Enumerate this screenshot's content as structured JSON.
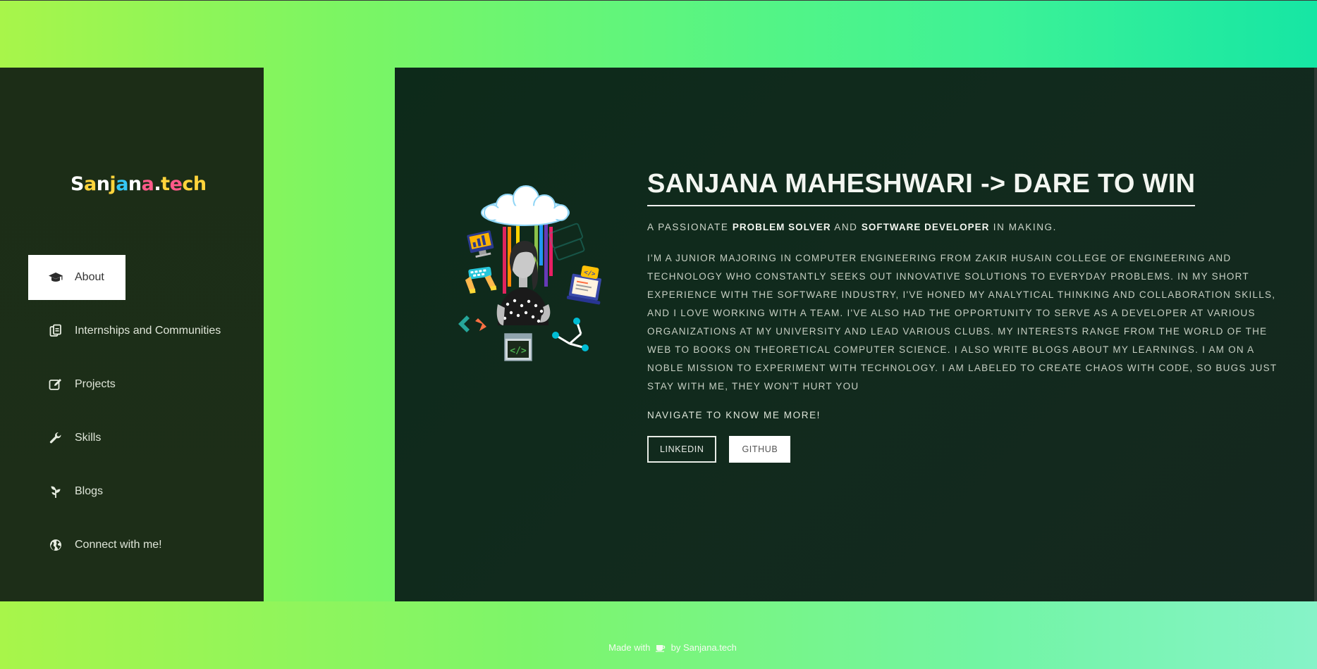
{
  "brand": {
    "letters": [
      {
        "ch": "S",
        "color": "#ffffff"
      },
      {
        "ch": "a",
        "color": "#ffd43b"
      },
      {
        "ch": "n",
        "color": "#ffffff"
      },
      {
        "ch": "j",
        "color": "#ffd43b"
      },
      {
        "ch": "a",
        "color": "#36c7f5"
      },
      {
        "ch": "n",
        "color": "#ffffff"
      },
      {
        "ch": "a",
        "color": "#ff5a8a"
      },
      {
        "ch": ".",
        "color": "#ffffff"
      },
      {
        "ch": "t",
        "color": "#ffd43b"
      },
      {
        "ch": "e",
        "color": "#ff5a8a"
      },
      {
        "ch": "c",
        "color": "#ffd43b"
      },
      {
        "ch": "h",
        "color": "#ffd43b"
      }
    ]
  },
  "sidebar": {
    "items": [
      {
        "label": "About",
        "icon": "graduation-cap-icon",
        "active": true
      },
      {
        "label": "Internships and Communities",
        "icon": "clipboard-copy-icon",
        "active": false
      },
      {
        "label": "Projects",
        "icon": "edit-icon",
        "active": false
      },
      {
        "label": "Skills",
        "icon": "wrench-icon",
        "active": false
      },
      {
        "label": "Blogs",
        "icon": "seedling-icon",
        "active": false
      },
      {
        "label": "Connect with me!",
        "icon": "globe-icon",
        "active": false
      }
    ]
  },
  "main": {
    "headline": "SANJANA MAHESHWARI -> DARE TO WIN",
    "tagline": {
      "prefix": "A PASSIONATE ",
      "bold1": "PROBLEM SOLVER",
      "mid": " AND ",
      "bold2": "SOFTWARE DEVELOPER",
      "suffix": " IN MAKING."
    },
    "bio": "I'M A JUNIOR MAJORING IN COMPUTER ENGINEERING FROM ZAKIR HUSAIN COLLEGE OF ENGINEERING AND TECHNOLOGY WHO CONSTANTLY SEEKS OUT INNOVATIVE SOLUTIONS TO EVERYDAY PROBLEMS. IN MY SHORT EXPERIENCE WITH THE SOFTWARE INDUSTRY, I'VE HONED MY ANALYTICAL THINKING AND COLLABORATION SKILLS, AND I LOVE WORKING WITH A TEAM. I'VE ALSO HAD THE OPPORTUNITY TO SERVE AS A DEVELOPER AT VARIOUS ORGANIZATIONS AT MY UNIVERSITY AND LEAD VARIOUS CLUBS. MY INTERESTS RANGE FROM THE WORLD OF THE WEB TO BOOKS ON THEORETICAL COMPUTER SCIENCE. I ALSO WRITE BLOGS ABOUT MY LEARNINGS. I AM ON A NOBLE MISSION TO EXPERIMENT WITH TECHNOLOGY. I AM LABELED TO CREATE CHAOS WITH CODE, SO BUGS JUST STAY WITH ME, THEY WON'T HURT YOU",
    "navigate": "NAVIGATE TO KNOW ME MORE!",
    "buttons": {
      "linkedin": "LINKEDIN",
      "github": "GITHUB"
    },
    "illustration_code_text": "</>"
  },
  "footer": {
    "prefix": "Made with",
    "icon": "coffee-cup-icon",
    "by": "by",
    "brand": "Sanjana.tech"
  },
  "colors": {
    "sidebar_bg": "#1c2d17",
    "main_bg": "#0f2a1b",
    "accent_gradient_start": "#a8f54a",
    "accent_gradient_end": "#16e6a4"
  }
}
